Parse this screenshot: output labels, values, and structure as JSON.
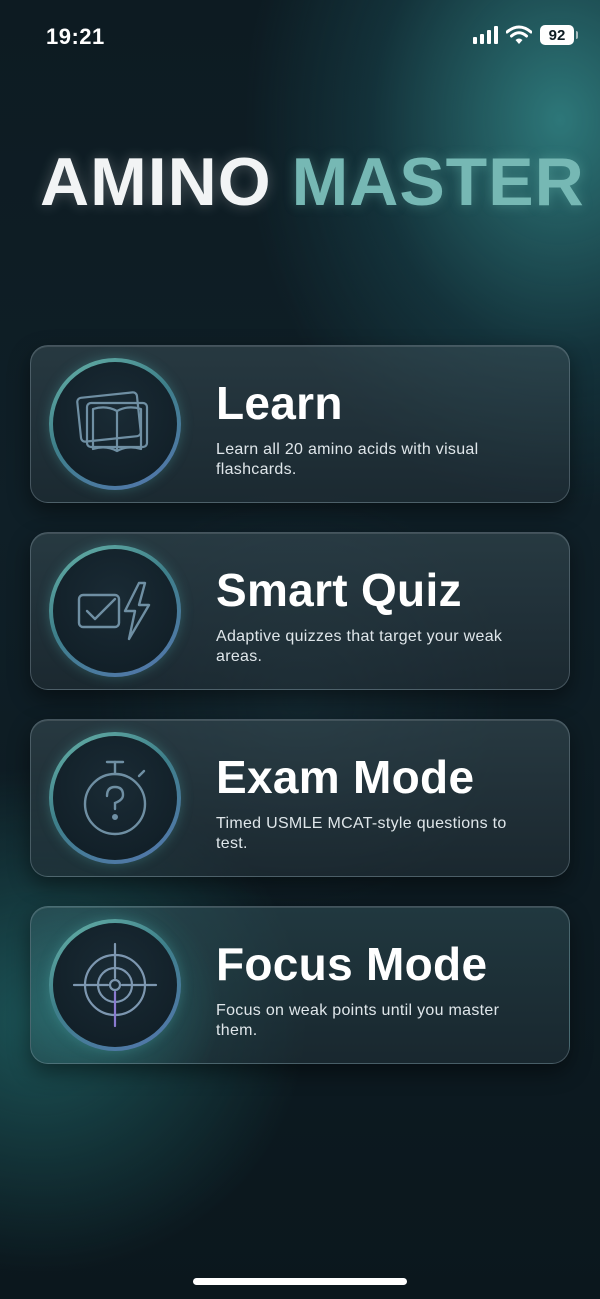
{
  "status_bar": {
    "time": "19:21",
    "battery": "92",
    "icons": [
      "signal-icon",
      "wifi-icon",
      "battery-icon"
    ]
  },
  "app": {
    "title_part1": "AMINO",
    "title_part2": "MASTER"
  },
  "modes": [
    {
      "title": "Learn",
      "description": "Learn all 20 amino acids with visual flashcards.",
      "icon": "flashcards-book-icon"
    },
    {
      "title": "Smart Quiz",
      "description": "Adaptive quizzes that target your weak areas.",
      "icon": "quiz-check-lightning-icon"
    },
    {
      "title": "Exam Mode",
      "description": "Timed USMLE MCAT-style questions to test.",
      "icon": "stopwatch-question-icon"
    },
    {
      "title": "Focus Mode",
      "description": "Focus on weak points until you master them.",
      "icon": "target-crosshair-icon"
    }
  ],
  "colors": {
    "title_accent": "#76b8b4",
    "ring_start": "#67b3a8",
    "ring_end": "#5576b0"
  }
}
